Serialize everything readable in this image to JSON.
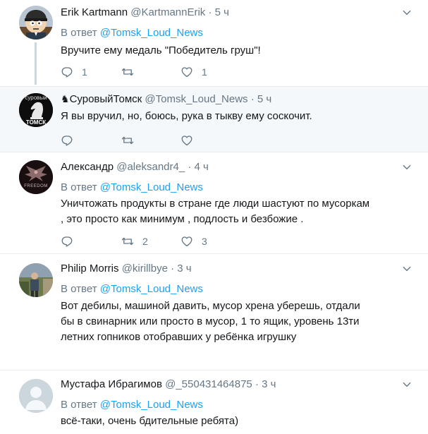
{
  "tweets": [
    {
      "name": "Erik Kartmann",
      "handle": "@KartmannErik",
      "dot": "·",
      "time": "5 ч",
      "reply_prefix": "В ответ",
      "reply_mention": "@Tomsk_Loud_News",
      "lines": [
        "Вручите ему медаль \"Победитель груш\"!"
      ],
      "reply_count": "1",
      "retweet_count": "",
      "like_count": "1"
    },
    {
      "name_icon": "♞",
      "name": "СуровыйТомск",
      "handle": "@Tomsk_Loud_News",
      "dot": "·",
      "time": "5 ч",
      "lines": [
        "Я вы вручил, но, боюсь, рука в тыкву ему соскочит."
      ],
      "reply_count": "",
      "retweet_count": "",
      "like_count": "",
      "avatar_text_top": "суровый",
      "avatar_text_bottom": "ТОМСК"
    },
    {
      "name": "Александр",
      "handle": "@aleksandr4_",
      "dot": "·",
      "time": "4 ч",
      "reply_prefix": "В ответ",
      "reply_mention": "@Tomsk_Loud_News",
      "lines": [
        "Уничтожать продукты в стране где люди шастуют по мусоркам",
        ", это просто как минимум , подлость и безбожие ."
      ],
      "reply_count": "",
      "retweet_count": "2",
      "like_count": "3",
      "avatar_text": "FREEDOM"
    },
    {
      "name": "Philip Morris",
      "handle": "@kirillbye",
      "dot": "·",
      "time": "3 ч",
      "reply_prefix": "В ответ",
      "reply_mention": "@Tomsk_Loud_News",
      "lines": [
        "Вот дебилы,  машиной давить,  мусор хрена уберешь,  отдали",
        "бы в свинарник или просто в мусор,  1 то ящик,  уровень 13ти",
        "летних гопников отобравших у ребёнка игрушку"
      ],
      "reply_count": "",
      "retweet_count": "",
      "like_count": ""
    },
    {
      "name": "Мустафа Ибрагимов",
      "handle": "@_550431464875",
      "dot": "·",
      "time": "3 ч",
      "reply_prefix": "В ответ",
      "reply_mention": "@Tomsk_Loud_News",
      "lines": [
        "всё-таки, очень бдительные ребята)"
      ],
      "reply_count": "",
      "retweet_count": "",
      "like_count": ""
    }
  ],
  "colors": {
    "link": "#1da1f2",
    "muted": "#657786",
    "text": "#14171a",
    "thread_line": "#c4d9ec",
    "highlight_bg": "#f5f8fa"
  },
  "icons": [
    "reply-icon",
    "retweet-icon",
    "like-icon",
    "chevron-down-icon"
  ]
}
